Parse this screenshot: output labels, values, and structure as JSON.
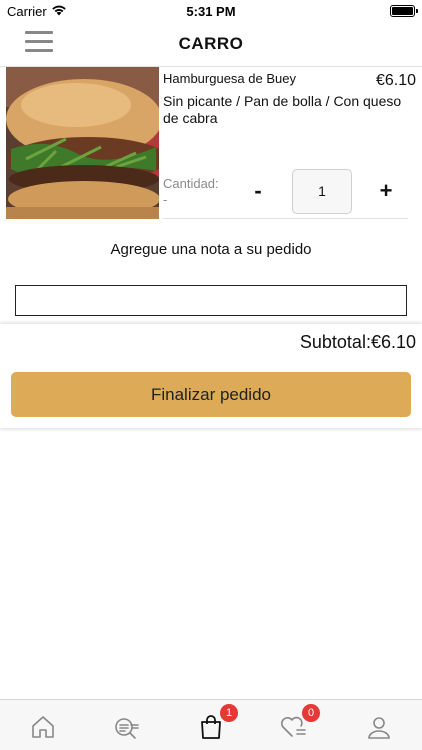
{
  "status_bar": {
    "carrier": "Carrier",
    "time": "5:31 PM"
  },
  "header": {
    "title": "CARRO",
    "menu_icon": "hamburger-menu-icon"
  },
  "cart": {
    "items": [
      {
        "name": "Hamburguesa de Buey",
        "price": "€6.10",
        "options": "Sin picante / Pan de bolla / Con queso de cabra",
        "quantity_label": "Cantidad:",
        "quantity_sub": "-",
        "quantity": "1",
        "minus_label": "-",
        "plus_label": "+",
        "image": "burger-photo"
      }
    ]
  },
  "note": {
    "label": "Agregue una nota a su pedido",
    "value": "",
    "placeholder": ""
  },
  "checkout": {
    "subtotal": "Subtotal:€6.10",
    "button_label": "Finalizar pedido",
    "button_color": "#ddaa58"
  },
  "tab_bar": {
    "tabs": [
      {
        "icon": "home-icon"
      },
      {
        "icon": "search-menu-icon"
      },
      {
        "icon": "shopping-bag-icon",
        "badge": "1"
      },
      {
        "icon": "heart-list-icon",
        "badge": "0"
      },
      {
        "icon": "user-icon"
      }
    ],
    "badge_color": "#e53935"
  }
}
